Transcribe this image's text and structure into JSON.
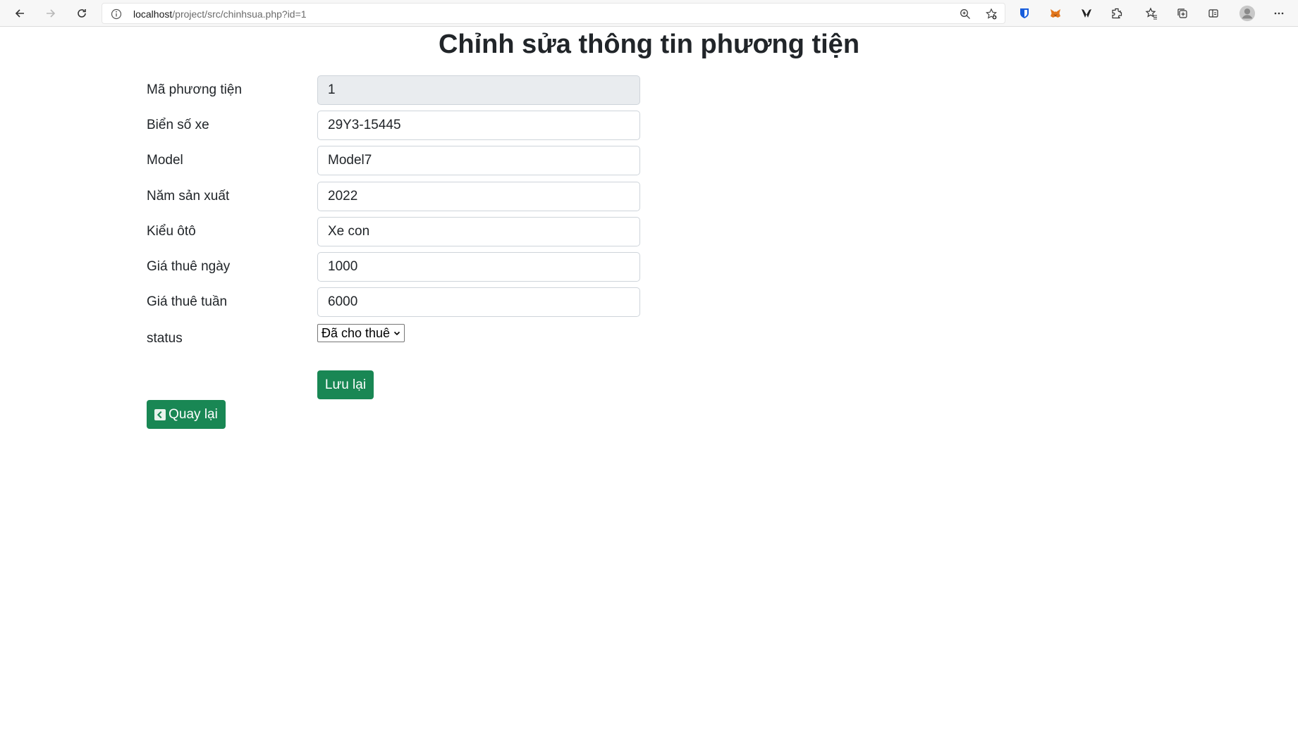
{
  "browser": {
    "url_host": "localhost",
    "url_path": "/project/src/chinhsua.php?id=1"
  },
  "page": {
    "title": "Chỉnh sửa thông tin phương tiện"
  },
  "form": {
    "fields": [
      {
        "label": "Mã phương tiện",
        "value": "1"
      },
      {
        "label": "Biển số xe",
        "value": "29Y3-15445"
      },
      {
        "label": "Model",
        "value": "Model7"
      },
      {
        "label": "Năm sản xuất",
        "value": "2022"
      },
      {
        "label": "Kiểu ôtô",
        "value": "Xe con"
      },
      {
        "label": "Giá thuê ngày",
        "value": "1000"
      },
      {
        "label": "Giá thuê tuần",
        "value": "6000"
      }
    ],
    "status_label": "status",
    "status_selected": "Đã cho thuê",
    "save_label": "Lưu lại",
    "back_label": "Quay lại"
  },
  "colors": {
    "button": "#198754",
    "readonly_bg": "#e9ecef"
  },
  "icons": [
    "back-arrow-icon",
    "forward-arrow-icon",
    "refresh-icon",
    "info-icon",
    "zoom-icon",
    "favorite-add-icon",
    "bitwarden-icon",
    "metamask-icon",
    "wallet-icon",
    "extensions-icon",
    "favorites-icon",
    "collections-icon",
    "sidebar-icon",
    "profile-avatar-icon",
    "more-icon",
    "chevron-left-icon",
    "chevron-down-icon"
  ]
}
